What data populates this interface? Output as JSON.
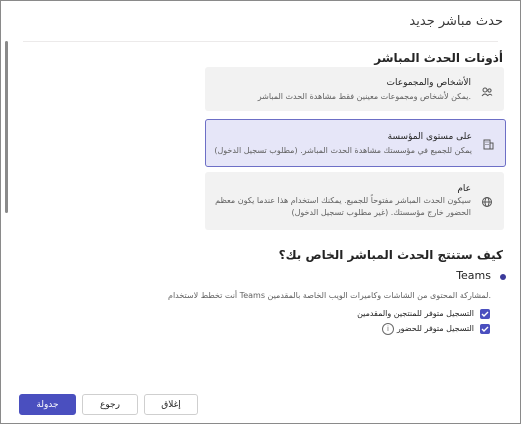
{
  "dialog": {
    "title": "حدث مباشر جديد"
  },
  "tools_section": {
    "title": "أذونات الحدث المباشر",
    "options": [
      {
        "icon": "people-icon",
        "title": "الأشخاص والمجموعات",
        "description": "يمكن لأشخاص ومجموعات معينين فقط مشاهدة الحدث المباشر.",
        "selected": false
      },
      {
        "icon": "building-icon",
        "title": "على مستوى المؤسسة",
        "description": "يمكن للجميع في مؤسستك مشاهدة الحدث المباشر. (مطلوب تسجيل الدخول)",
        "selected": true
      },
      {
        "icon": "globe-icon",
        "title": "عام",
        "description": "سيكون الحدث المباشر مفتوحاً للجميع. يمكنك استخدام هذا عندما يكون معظم الحضور خارج مؤسستك. (غير مطلوب تسجيل الدخول)",
        "selected": false
      }
    ]
  },
  "production_section": {
    "title": "كيف ستنتج الحدث المباشر الخاص بك؟",
    "teams_label": "Teams",
    "teams_description": "أنت تخطط لاستخدام Teams لمشاركة المحتوى من الشاشات وكاميرات الويب الخاصة بالمقدمين.",
    "checkboxes": [
      {
        "label": "التسجيل متوفر للمنتجين والمقدمين",
        "checked": true
      },
      {
        "label": "التسجيل متوفر للحضور",
        "checked": true
      }
    ]
  },
  "footer": {
    "close_label": "إغلاق",
    "back_label": "رجوع",
    "schedule_label": "جدولة"
  },
  "colors": {
    "accent": "#4a4fbf",
    "selected_card_bg": "#e6e6f8",
    "selected_card_border": "#6d6fc6",
    "card_bg": "#f2f2f2"
  }
}
